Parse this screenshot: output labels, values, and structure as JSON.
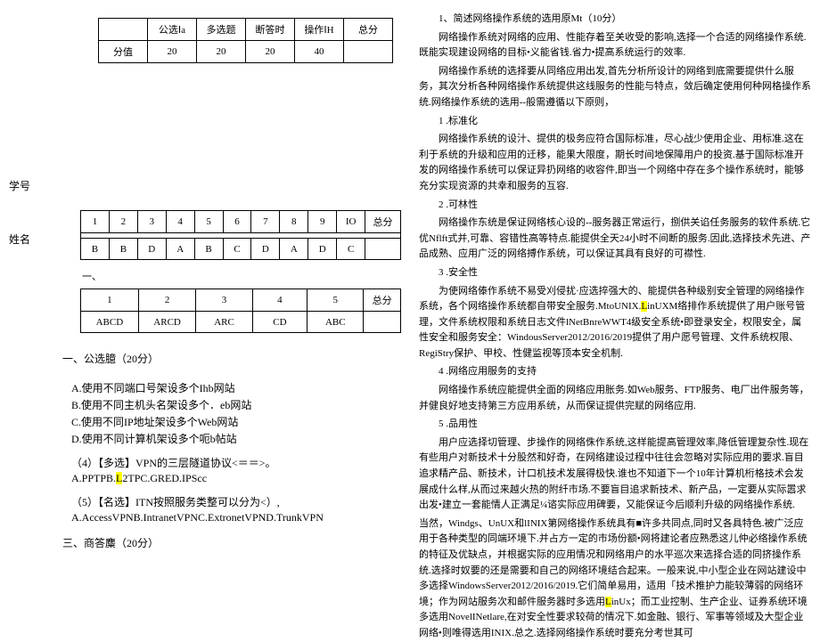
{
  "t1": {
    "h": [
      "",
      "公选Ⅰa",
      "多选题",
      "断答时",
      "操作ⅠH",
      "总分"
    ],
    "r": [
      "分值",
      "20",
      "20",
      "20",
      "40",
      ""
    ]
  },
  "side": {
    "xuehao": "学号",
    "xingming": "姓名"
  },
  "t2": {
    "h": [
      "1",
      "2",
      "3",
      "4",
      "5",
      "6",
      "7",
      "8",
      "9",
      "IO",
      "总分"
    ],
    "r": [
      "B",
      "B",
      "D",
      "A",
      "B",
      "C",
      "D",
      "A",
      "D",
      "C",
      ""
    ]
  },
  "dash": "一、",
  "t3": {
    "h": [
      "1",
      "2",
      "3",
      "4",
      "5",
      "总分"
    ],
    "r": [
      "ABCD",
      "ARCD",
      "ARC",
      "CD",
      "ABC",
      ""
    ]
  },
  "sec1": "一、公选臆（20分）",
  "opts": {
    "A": "A.使用不同端口号架设多个Ihb网站",
    "B": "B.使用不同主机头名架设多个．eb网站",
    "C": "C.使用不同IP地址架设多个Web网站",
    "D": "D.使用不同计算机架设多个呃b帖站"
  },
  "q4": {
    "t": "（4）【多选】VPN的三层隧道协议<＝＝>。",
    "a": "A.PPTPB.",
    "ah": "L",
    "a2": "2TPC.GRED.IPScc"
  },
  "q5": {
    "t": "（5）【名选】ITN按照服务类整可以分为<）,",
    "a": "A.AccessVPNB.IntranetVPNC.ExtronetVPND.TrunkVPN"
  },
  "sec3": "三、商答麋（20分）",
  "r": {
    "p1": "1、简述网络操作系统的选用原Mt（10分）",
    "p2": "网络操作系统对网络的应用、性能存着至关收受的影响,选择一个合适的网络操作系统.既能实现建设网络的目标•义能省钱.省力•提高系统运行的效率.",
    "p3": "网络操作系统的选择要从同络应用出发,首先分析所设计的网络到底需要提供什么服务，其次分析各种网络操作系统提供这线服务的性能与特点，敛后确定使用何种网格操作系统.网络操作系统的选用--般需遵循以下原则，",
    "p4": "1 .标准化",
    "p5": "网络操作系统的设汁、提供的极务应符合国际标准，尽心战少使用企业、用标准.这在利于系统的升级和应用的迁移，能果大限度，期长时间地保障用户的投资.基于国际标准开发的网络操作系统可以保证异扔网络的收容件,即当一个网络中存在多个操作系统时，能够充分实现资源的共幸和服务的互容.",
    "p6": "2 .可林性",
    "p7": "网络操作东统是保证网络核心设的--服务器正常运行，捌供关谄任务服务的软件系统.它优Nflft式并,可靠、容错性高等特点.能提供全天24小时不间断的服务.因此,选择技术先进、产品成熟、应用广泛的网络搏作系统，可以保证其具有良好的可襟性.",
    "p8": "3 .安全性",
    "p9a": "为使网络傣作系统不易受刈侵扰·应选捽强大的、能提供各种级别安全管理的网络操作系统，各个网络操作系统都自带安全服务.MtoUNIX.",
    "p9h": "L",
    "p9b": "inUXM络排作系统提供了用户账号管理，文件系统权限和系统日志文件lNetBnreWWT4级安全系统•即登录安全，权限安全，属性安全和服务安全：WindousServer2012/2016/2019提供了用户愿号管理、文件系统权限、RegiStry保护、甲校、性健监视等顶本安全机制.",
    "p10": "4 .网络应用服务的支持",
    "p11": "网络操作系统应能提供全面的网络应用胀务.如Web服务、FTP服务、电厂出件服务等，并健良好地支持第三方应用系统，从而保证提供完赋的网络应用.",
    "p12": "5 .品用性",
    "p13": "用户应选择切管理、步操作的网络侏作系统,这样能提高管理效率,降低管理复杂性.现在有些用户对新技术十分股然和好奇，在网络建设过程中往往会忽略对实际应用的要求.盲目追求精产品、新技术，计口机技术发展得极快.谁也不知道下一个10年计算机桁格技术会发展成什么样,从而过来越火热的附纤市场.不要盲目追求新技术、新产品，一定要从实际嚣求出发•建立一套能情人正满足¼谘实际应用碑要，又能保证今后顺利升级的网络操作系统.",
    "p14a": "当然，Windgs、UnUX和lINIX第网络操作系统具有■许多共同点,同时又各具特色.被广泛应用于各种类型的同端环境下.并占方一定的市场份额•网将建论者应熟悉这儿仲必络操作系统的特征及优缺点，并根据实际的应用情况和网络用户的水平巡次来选择合适的同挤操作系统.选择时奴要的还是需要和自己的网络环境结合起来。一般来说,中小型企业在网站建设中多选择WindowsServer2012/2016/2019.它们简单易用，适用「技术推护力能较薄弱的网络环境；作为网站服务次和邮件服务器时多选用",
    "p14h": "L",
    "p14b": "inUx；而工业控制、生产企业、证券系统环境多选用NovelINetlare,在对安全性要求较荷的情况下.如金融、银行、军事等领域及大型企业网络•则唯得选用INIX.总之.选择网络操作系统时要充分考世其可"
  }
}
